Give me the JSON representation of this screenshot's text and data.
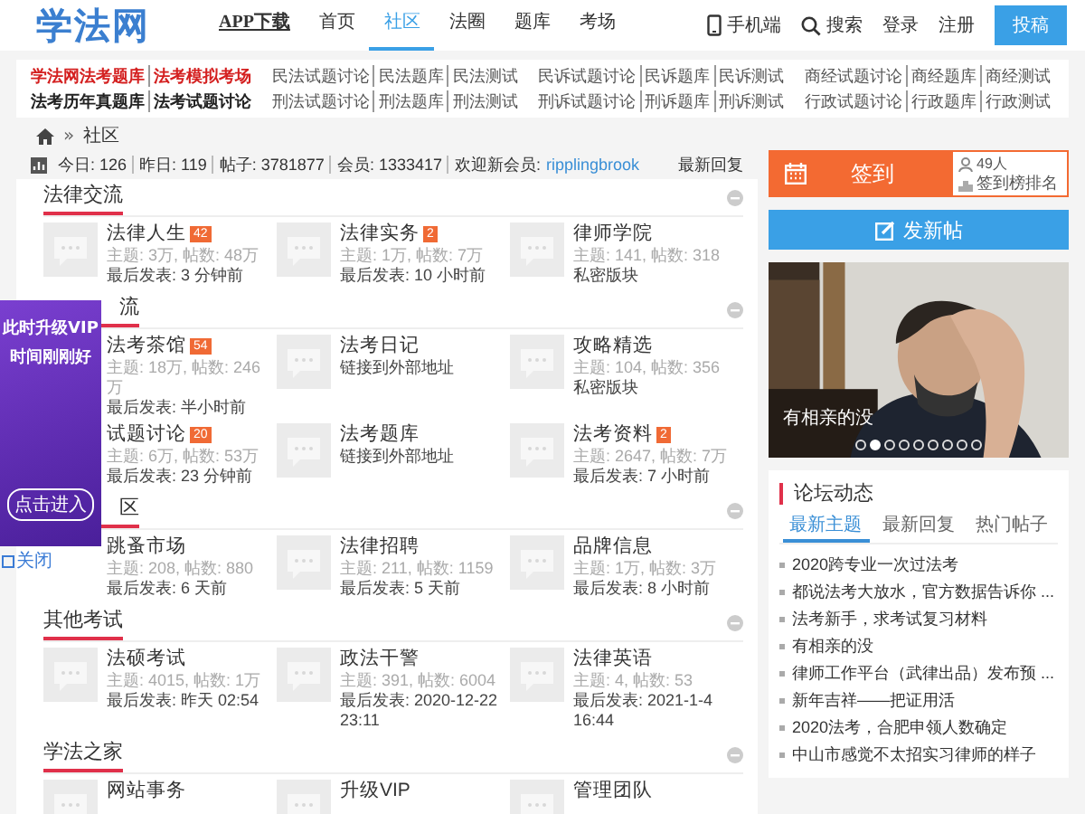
{
  "header": {
    "logo": "学法网",
    "nav": [
      {
        "label": "APP下载",
        "kind": "app",
        "selected": false
      },
      {
        "label": "首页",
        "kind": "link",
        "selected": false
      },
      {
        "label": "社区",
        "kind": "link",
        "selected": true
      },
      {
        "label": "法圈",
        "kind": "link",
        "selected": false
      },
      {
        "label": "题库",
        "kind": "link",
        "selected": false
      },
      {
        "label": "考场",
        "kind": "link",
        "selected": false
      }
    ],
    "mobile": "手机端",
    "search": "搜索",
    "login": "登录",
    "register": "注册",
    "post_button": "投稿"
  },
  "quick_links": [
    {
      "kind": "red",
      "items": [
        "学法网法考题库",
        "法考模拟考场"
      ]
    },
    {
      "kind": "plain",
      "items": [
        "民法试题讨论",
        "民法题库",
        "民法测试"
      ]
    },
    {
      "kind": "plain",
      "items": [
        "民诉试题讨论",
        "民诉题库",
        "民诉测试"
      ]
    },
    {
      "kind": "plain",
      "items": [
        "商经试题讨论",
        "商经题库",
        "商经测试"
      ]
    },
    {
      "kind": "bold",
      "items": [
        "法考历年真题库",
        "法考试题讨论"
      ]
    },
    {
      "kind": "plain",
      "items": [
        "刑法试题讨论",
        "刑法题库",
        "刑法测试"
      ]
    },
    {
      "kind": "plain",
      "items": [
        "刑诉试题讨论",
        "刑诉题库",
        "刑诉测试"
      ]
    },
    {
      "kind": "plain",
      "items": [
        "行政试题讨论",
        "行政题库",
        "行政测试"
      ]
    }
  ],
  "breadcrumb": {
    "separator": "»",
    "items": [
      "社区"
    ]
  },
  "stats": {
    "items": [
      "今日: 126",
      "昨日: 119",
      "帖子: 3781877",
      "会员: 1333417"
    ],
    "welcome": "欢迎新会员:",
    "new_member": "ripplingbrook",
    "latest_replies": "最新回复"
  },
  "sections": [
    {
      "title": "法律交流",
      "forums": [
        {
          "name": "法律人生",
          "badge": "42",
          "lines": [
            {
              "kind": "stats",
              "text": "主题: 3万, 帖数: 48万"
            },
            {
              "kind": "info",
              "text": "最后发表: 3 分钟前"
            }
          ]
        },
        {
          "name": "法律实务",
          "badge": "2",
          "lines": [
            {
              "kind": "stats",
              "text": "主题: 1万, 帖数: 7万"
            },
            {
              "kind": "info",
              "text": "最后发表: 10 小时前"
            }
          ]
        },
        {
          "name": "律师学院",
          "lines": [
            {
              "kind": "stats",
              "text": "主题: 141, 帖数: 318"
            },
            {
              "kind": "info",
              "text": "私密版块"
            }
          ]
        }
      ]
    },
    {
      "title": "流",
      "covered": true,
      "forums": [
        {
          "name": "法考茶馆",
          "badge": "54",
          "lines": [
            {
              "kind": "stats",
              "text": "主题: 18万, 帖数: 246万"
            },
            {
              "kind": "info",
              "text": "最后发表: 半小时前"
            }
          ]
        },
        {
          "name": "法考日记",
          "lines": [
            {
              "kind": "info",
              "text": "链接到外部地址"
            }
          ]
        },
        {
          "name": "攻略精选",
          "lines": [
            {
              "kind": "stats",
              "text": "主题: 104, 帖数: 356"
            },
            {
              "kind": "info",
              "text": "私密版块"
            }
          ]
        },
        {
          "name": "试题讨论",
          "badge": "20",
          "lines": [
            {
              "kind": "stats",
              "text": "主题: 6万, 帖数: 53万"
            },
            {
              "kind": "info",
              "text": "最后发表: 23 分钟前"
            }
          ]
        },
        {
          "name": "法考题库",
          "lines": [
            {
              "kind": "info",
              "text": "链接到外部地址"
            }
          ]
        },
        {
          "name": "法考资料",
          "badge": "2",
          "lines": [
            {
              "kind": "stats",
              "text": "主题: 2647, 帖数: 7万"
            },
            {
              "kind": "info",
              "text": "最后发表: 7 小时前"
            }
          ]
        }
      ]
    },
    {
      "title": "区",
      "covered": true,
      "forums": [
        {
          "name": "跳蚤市场",
          "lines": [
            {
              "kind": "stats",
              "text": "主题: 208, 帖数: 880"
            },
            {
              "kind": "info",
              "text": "最后发表: 6 天前"
            }
          ]
        },
        {
          "name": "法律招聘",
          "lines": [
            {
              "kind": "stats",
              "text": "主题: 211, 帖数: 1159"
            },
            {
              "kind": "info",
              "text": "最后发表: 5 天前"
            }
          ]
        },
        {
          "name": "品牌信息",
          "lines": [
            {
              "kind": "stats",
              "text": "主题: 1万, 帖数: 3万"
            },
            {
              "kind": "info",
              "text": "最后发表: 8 小时前"
            }
          ]
        }
      ]
    },
    {
      "title": "其他考试",
      "forums": [
        {
          "name": "法硕考试",
          "lines": [
            {
              "kind": "stats",
              "text": "主题: 4015, 帖数: 1万"
            },
            {
              "kind": "info",
              "text": "最后发表: 昨天 02:54"
            }
          ]
        },
        {
          "name": "政法干警",
          "lines": [
            {
              "kind": "stats",
              "text": "主题: 391, 帖数: 6004"
            },
            {
              "kind": "info",
              "text": "最后发表: 2020-12-22 23:11"
            }
          ]
        },
        {
          "name": "法律英语",
          "lines": [
            {
              "kind": "stats",
              "text": "主题: 4, 帖数: 53"
            },
            {
              "kind": "info",
              "text": "最后发表: 2021-1-4 16:44"
            }
          ]
        }
      ]
    },
    {
      "title": "学法之家",
      "forums": [
        {
          "name": "网站事务"
        },
        {
          "name": "升级VIP"
        },
        {
          "name": "管理团队"
        }
      ]
    }
  ],
  "promo": {
    "lines": [
      "此时升级VIP",
      "时间刚刚好"
    ],
    "button": "点击进入",
    "close": "关闭"
  },
  "sidebar": {
    "checkin": {
      "label": "签到",
      "count": "49人",
      "ranking": "签到榜排名"
    },
    "new_post": "发新帖",
    "carousel": {
      "caption": "有相亲的没",
      "dots": [
        {
          "selected": false
        },
        {
          "selected": true
        },
        {
          "selected": false
        },
        {
          "selected": false
        },
        {
          "selected": false
        },
        {
          "selected": false
        },
        {
          "selected": false
        },
        {
          "selected": false
        },
        {
          "selected": false
        }
      ]
    },
    "activity": {
      "title": "论坛动态",
      "tabs": [
        {
          "label": "最新主题",
          "selected": true
        },
        {
          "label": "最新回复",
          "selected": false
        },
        {
          "label": "热门帖子",
          "selected": false
        }
      ],
      "items": [
        "2020跨专业一次过法考",
        "都说法考大放水，官方数据告诉你 ...",
        "法考新手，求考试复习材料",
        "有相亲的没",
        "律师工作平台（武律出品）发布预 ...",
        "新年吉祥——把证用活",
        "2020法考，合肥申领人数确定",
        "中山市感觉不太招实习律师的样子"
      ]
    }
  }
}
